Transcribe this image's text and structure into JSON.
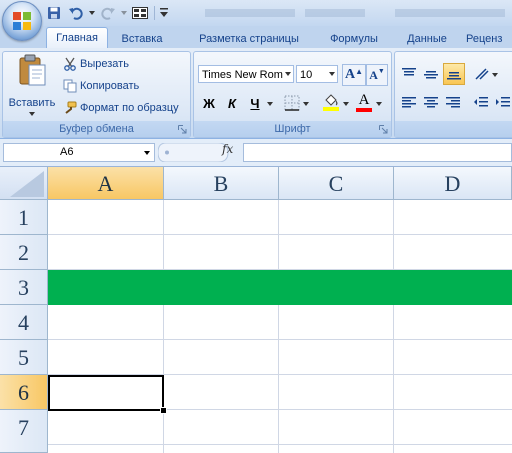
{
  "qat": {
    "icons": [
      "save-icon",
      "undo-icon",
      "redo-icon",
      "layout-icon",
      "customize-icon"
    ]
  },
  "tabs": [
    {
      "label": "Главная",
      "active": true
    },
    {
      "label": "Вставка"
    },
    {
      "label": "Разметка страницы"
    },
    {
      "label": "Формулы"
    },
    {
      "label": "Данные"
    },
    {
      "label": "Реценз"
    }
  ],
  "clipboard": {
    "paste_label": "Вставить",
    "cut_label": "Вырезать",
    "copy_label": "Копировать",
    "format_painter_label": "Формат по образцу",
    "group_label": "Буфер обмена"
  },
  "font": {
    "name": "Times New Rom",
    "size": "10",
    "bold": "Ж",
    "italic": "К",
    "underline": "Ч",
    "grow": "A",
    "shrink": "A",
    "font_color_letter": "A",
    "group_label": "Шрифт",
    "fill_color": "#ffff00",
    "font_color": "#ff0000"
  },
  "formula_bar": {
    "name_box": "A6",
    "fx": "fx",
    "value": ""
  },
  "columns": [
    "A",
    "B",
    "C",
    "D"
  ],
  "rows": [
    "1",
    "2",
    "3",
    "4",
    "5",
    "6",
    "7"
  ],
  "selection": {
    "column": "A",
    "row": "6"
  },
  "highlight": {
    "row": "3",
    "color": "#00b050"
  }
}
